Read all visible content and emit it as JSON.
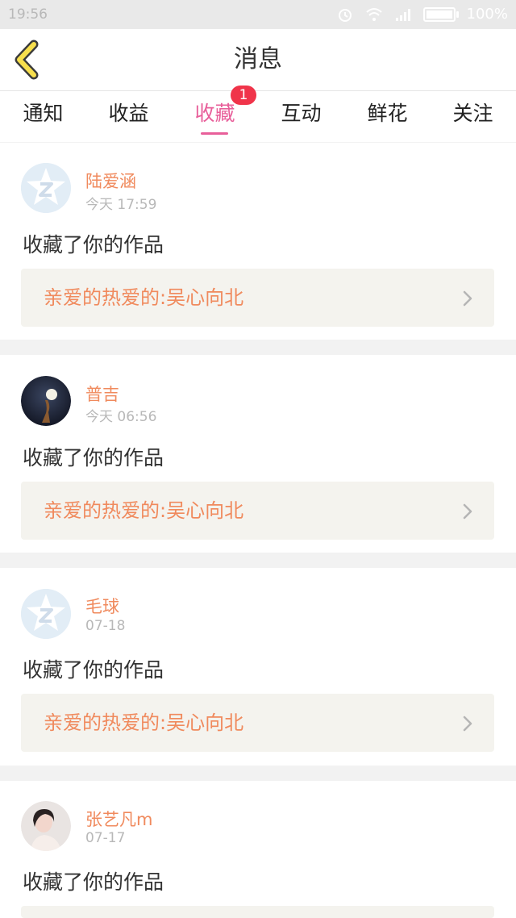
{
  "status_bar": {
    "time": "19:56",
    "battery": "100%",
    "battery_level": 1.0
  },
  "header": {
    "title": "消息",
    "back_icon": "chevron-left-icon"
  },
  "tabs": [
    {
      "label": "通知"
    },
    {
      "label": "收益"
    },
    {
      "label": "收藏",
      "active": true,
      "badge": "1"
    },
    {
      "label": "互动"
    },
    {
      "label": "鲜花"
    },
    {
      "label": "关注"
    }
  ],
  "messages": [
    {
      "username": "陆爱涵",
      "time": "今天 17:59",
      "text": "收藏了你的作品",
      "work": "亲爱的热爱的:吴心向北",
      "avatar": "default-avatar-icon"
    },
    {
      "username": "普吉",
      "time": "今天 06:56",
      "text": "收藏了你的作品",
      "work": "亲爱的热爱的:吴心向北",
      "avatar": "user-photo"
    },
    {
      "username": "毛球",
      "time": "07-18",
      "text": "收藏了你的作品",
      "work": "亲爱的热爱的:吴心向北",
      "avatar": "default-avatar-icon"
    },
    {
      "username": "张艺凡m",
      "time": "07-17",
      "text": "收藏了你的作品",
      "work": "",
      "avatar": "user-photo"
    }
  ],
  "colors": {
    "accent": "#e85f9a",
    "name": "#f08a5d",
    "badge": "#f0344a",
    "link_bg": "#f4f3ee"
  }
}
